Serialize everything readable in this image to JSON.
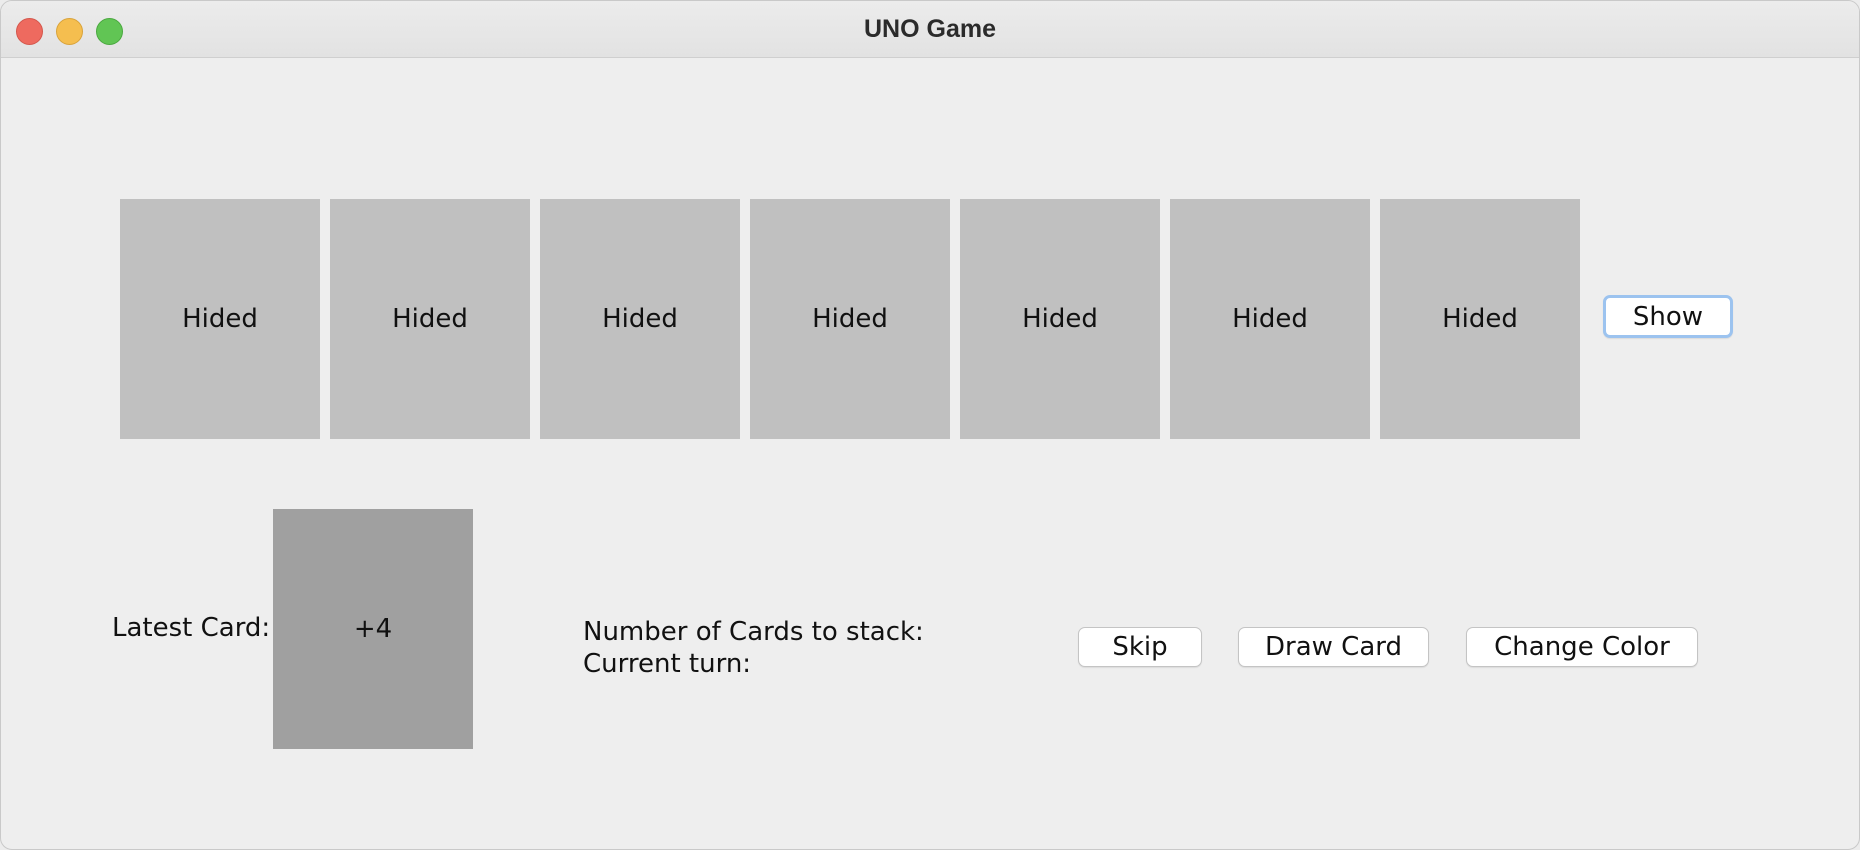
{
  "window": {
    "title": "UNO Game"
  },
  "opponent_hand": {
    "cards": [
      {
        "label": "Hided"
      },
      {
        "label": "Hided"
      },
      {
        "label": "Hided"
      },
      {
        "label": "Hided"
      },
      {
        "label": "Hided"
      },
      {
        "label": "Hided"
      },
      {
        "label": "Hided"
      }
    ],
    "show_button": "Show"
  },
  "discard": {
    "label": "Latest Card:",
    "card_value": "+4"
  },
  "status": {
    "stack_label": "Number of Cards to stack:",
    "turn_label": "Current turn:"
  },
  "actions": {
    "skip": "Skip",
    "draw": "Draw Card",
    "change_color": "Change Color"
  },
  "colors": {
    "hidden_card": "#c0c0c0",
    "latest_card": "#a0a0a0",
    "focus_ring": "#9cc3ef"
  }
}
